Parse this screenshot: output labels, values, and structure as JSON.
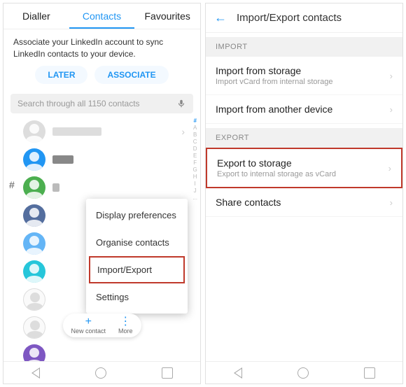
{
  "left": {
    "tabs": {
      "dialler": "Dialler",
      "contacts": "Contacts",
      "favourites": "Favourites"
    },
    "linkedin_msg": "Associate your LinkedIn account to sync LinkedIn contacts to your device.",
    "later": "LATER",
    "associate": "ASSOCIATE",
    "search_placeholder": "Search through all 1150 contacts",
    "index_hash": "#",
    "fab": {
      "new": "New contact",
      "more": "More"
    },
    "popup": {
      "display": "Display preferences",
      "organise": "Organise contacts",
      "importexport": "Import/Export",
      "settings": "Settings"
    }
  },
  "right": {
    "title": "Import/Export contacts",
    "import_header": "IMPORT",
    "opt1_title": "Import from storage",
    "opt1_sub": "Import vCard from internal storage",
    "opt2_title": "Import from another device",
    "export_header": "EXPORT",
    "opt3_title": "Export to storage",
    "opt3_sub": "Export to internal storage as vCard",
    "opt4_title": "Share contacts"
  }
}
